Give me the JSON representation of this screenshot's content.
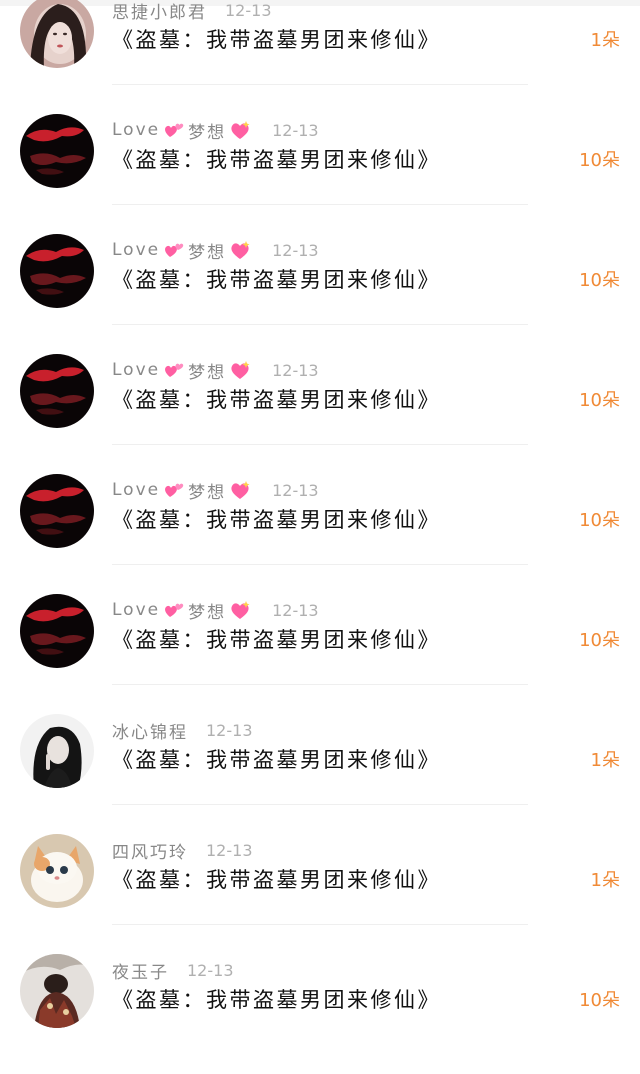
{
  "rows": [
    {
      "user": "思捷小郎君",
      "user_suffix": "",
      "date": "12-13",
      "title": "《盗墓：我带盗墓男团来修仙》",
      "count": "1朵",
      "avatar": "girl-portrait"
    },
    {
      "user": "Love",
      "user_suffix": "梦想",
      "date": "12-13",
      "title": "《盗墓：我带盗墓男团来修仙》",
      "count": "10朵",
      "avatar": "red-smoke"
    },
    {
      "user": "Love",
      "user_suffix": "梦想",
      "date": "12-13",
      "title": "《盗墓：我带盗墓男团来修仙》",
      "count": "10朵",
      "avatar": "red-smoke"
    },
    {
      "user": "Love",
      "user_suffix": "梦想",
      "date": "12-13",
      "title": "《盗墓：我带盗墓男团来修仙》",
      "count": "10朵",
      "avatar": "red-smoke"
    },
    {
      "user": "Love",
      "user_suffix": "梦想",
      "date": "12-13",
      "title": "《盗墓：我带盗墓男团来修仙》",
      "count": "10朵",
      "avatar": "red-smoke"
    },
    {
      "user": "Love",
      "user_suffix": "梦想",
      "date": "12-13",
      "title": "《盗墓：我带盗墓男团来修仙》",
      "count": "10朵",
      "avatar": "red-smoke"
    },
    {
      "user": "冰心锦程",
      "user_suffix": "",
      "date": "12-13",
      "title": "《盗墓：我带盗墓男团来修仙》",
      "count": "1朵",
      "avatar": "woman-dark-hair"
    },
    {
      "user": "四风巧玲",
      "user_suffix": "",
      "date": "12-13",
      "title": "《盗墓：我带盗墓男团来修仙》",
      "count": "1朵",
      "avatar": "white-cat"
    },
    {
      "user": "夜玉子",
      "user_suffix": "",
      "date": "12-13",
      "title": "《盗墓：我带盗墓男团来修仙》",
      "count": "10朵",
      "avatar": "figure-scene"
    }
  ],
  "colors": {
    "count": "#f08a36",
    "username": "#888888",
    "date": "#b0b0b0",
    "title": "#111111",
    "heart": "#ff5fa2"
  }
}
